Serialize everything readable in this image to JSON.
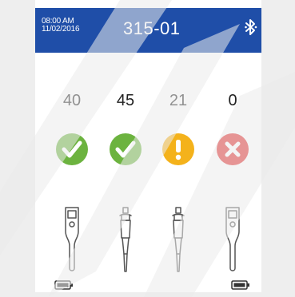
{
  "header": {
    "time": "08:00 AM",
    "date": "11/02/2016",
    "title": "315-01",
    "bluetooth_icon": "bluetooth-icon"
  },
  "channels": [
    {
      "count": "40",
      "status": "ok",
      "status_icon": "check-icon",
      "status_color": "#6cb33f",
      "device": "handheld-meter",
      "battery": true
    },
    {
      "count": "45",
      "status": "ok",
      "status_icon": "check-icon",
      "status_color": "#6cb33f",
      "device": "pipette",
      "battery": false
    },
    {
      "count": "21",
      "status": "warning",
      "status_icon": "exclamation-icon",
      "status_color": "#f4b21b",
      "device": "pipette",
      "battery": false
    },
    {
      "count": "0",
      "status": "error",
      "status_icon": "close-icon",
      "status_color": "#e02929",
      "device": "handheld-meter",
      "battery": true
    }
  ],
  "colors": {
    "header_bg": "#1f4ea8",
    "ok": "#6cb33f",
    "warning": "#f4b21b",
    "error": "#e02929"
  }
}
